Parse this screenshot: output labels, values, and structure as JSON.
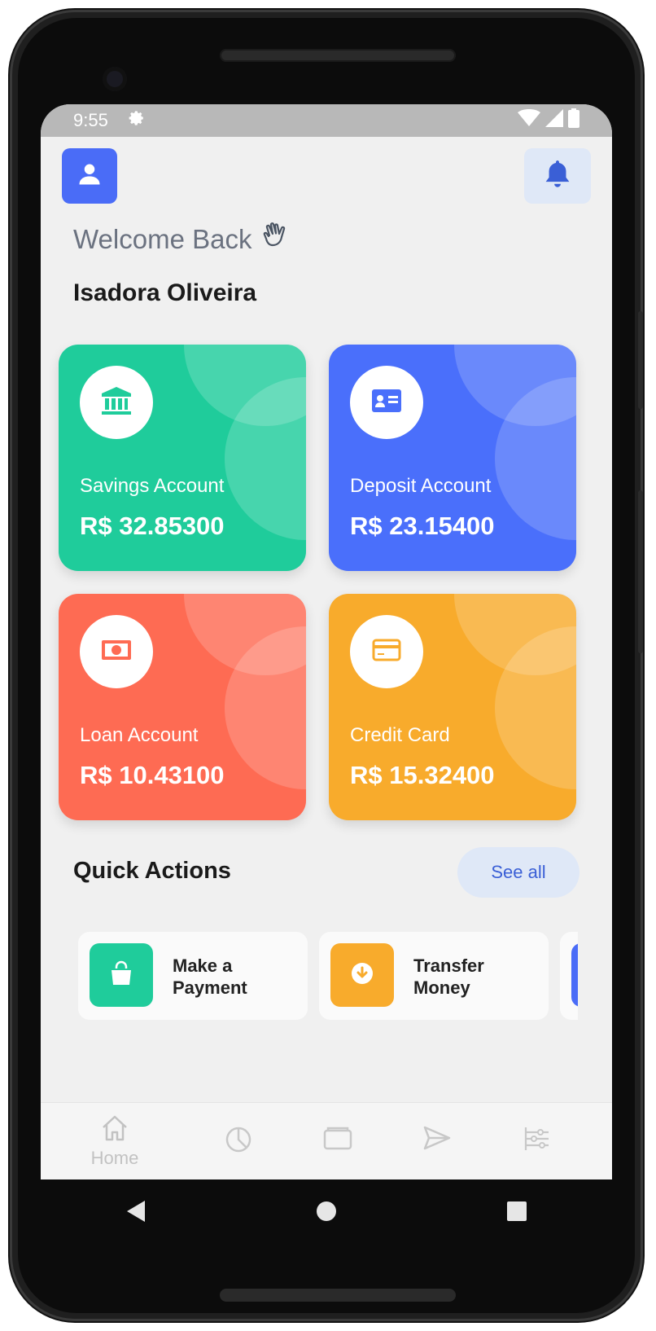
{
  "status_bar": {
    "time": "9:55"
  },
  "header": {
    "welcome_text": "Welcome Back",
    "user_name": "Isadora Oliveira"
  },
  "accounts": [
    {
      "label": "Savings Account",
      "amount": "R$ 32.85300",
      "color": "#1fcc9b",
      "icon": "bank-icon"
    },
    {
      "label": "Deposit Account",
      "amount": "R$ 23.15400",
      "color": "#4a6ffb",
      "icon": "id-card-icon"
    },
    {
      "label": "Loan Account",
      "amount": "R$ 10.43100",
      "color": "#fe6b53",
      "icon": "cash-icon"
    },
    {
      "label": "Credit Card",
      "amount": "R$ 15.32400",
      "color": "#f8ab2c",
      "icon": "credit-card-icon"
    }
  ],
  "quick_actions": {
    "title": "Quick Actions",
    "see_all_label": "See all",
    "items": [
      {
        "label": "Make a Payment",
        "color": "#1fcc9b",
        "icon": "shopping-bag-icon"
      },
      {
        "label": "Transfer Money",
        "color": "#f8ab2c",
        "icon": "download-icon"
      }
    ]
  },
  "bottom_nav": {
    "items": [
      {
        "label": "Home",
        "icon": "home-icon"
      },
      {
        "label": "",
        "icon": "pie-chart-icon"
      },
      {
        "label": "",
        "icon": "wallet-icon"
      },
      {
        "label": "",
        "icon": "send-icon"
      },
      {
        "label": "",
        "icon": "sliders-icon"
      }
    ]
  },
  "colors": {
    "primary": "#4a6cf7",
    "bell_bg": "#dfe8f7",
    "screen_bg": "#f0f0f0"
  }
}
